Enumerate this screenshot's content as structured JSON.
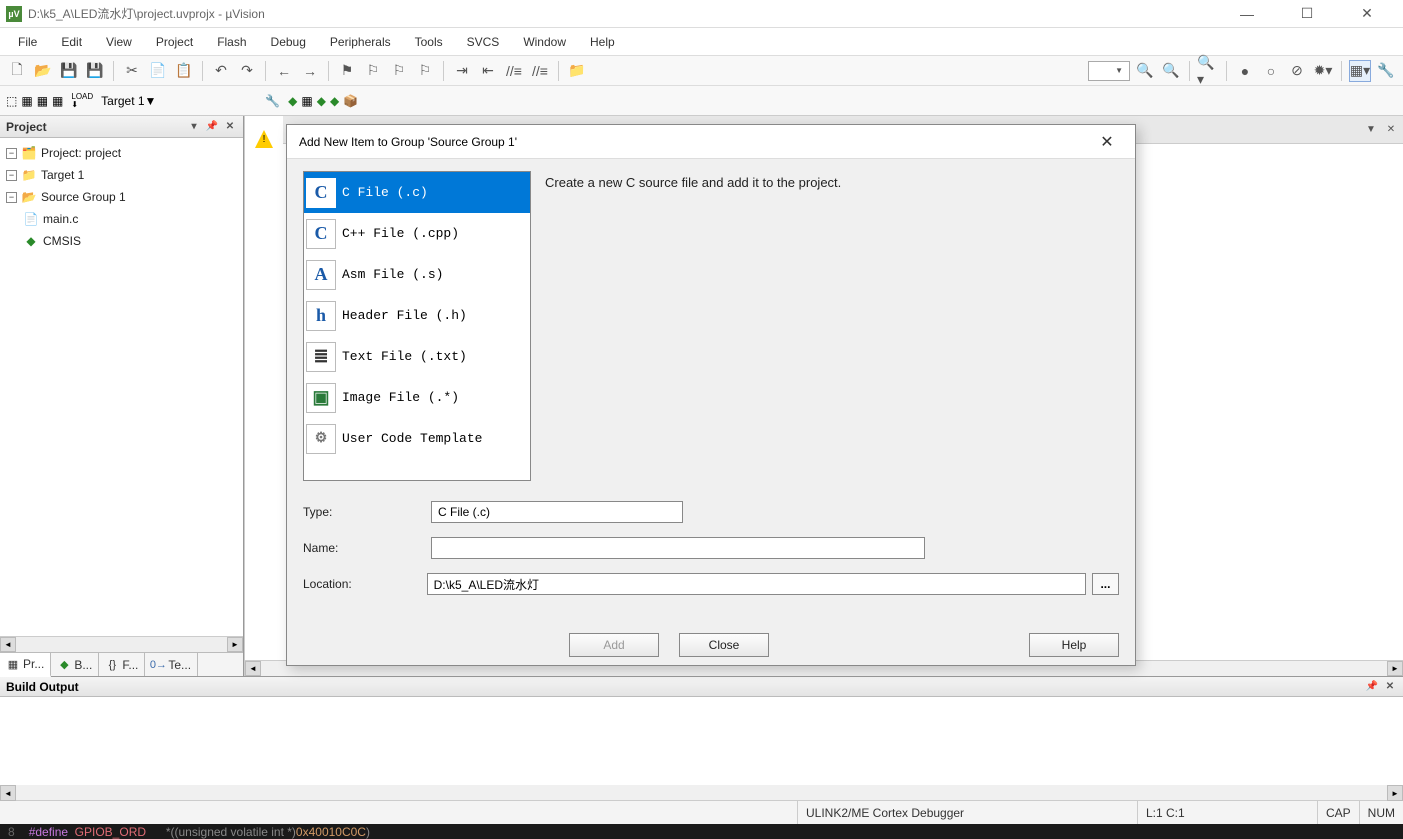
{
  "window": {
    "title": "D:\\k5_A\\LED流水灯\\project.uvprojx - µVision"
  },
  "menu": [
    "File",
    "Edit",
    "View",
    "Project",
    "Flash",
    "Debug",
    "Peripherals",
    "Tools",
    "SVCS",
    "Window",
    "Help"
  ],
  "toolbar2": {
    "target_label": "Target 1"
  },
  "project_panel": {
    "title": "Project",
    "root": "Project: project",
    "target": "Target 1",
    "group": "Source Group 1",
    "file1": "main.c",
    "cmsis": "CMSIS",
    "tabs": [
      "Pr...",
      "B...",
      "F...",
      "Te..."
    ]
  },
  "build_output": {
    "title": "Build Output"
  },
  "status": {
    "debugger": "ULINK2/ME Cortex Debugger",
    "line": "L:1 C:1",
    "cap": "CAP",
    "num": "NUM"
  },
  "bottom_code": {
    "ln": "8",
    "kw": "#define",
    "mac": "GPIOB_ORD",
    "cast": "*((unsigned volatile int *)",
    "num": "0x40010C0C",
    "tail": ")"
  },
  "dialog": {
    "title": "Add New Item to Group 'Source Group 1'",
    "desc": "Create a new C source file and add it to the project.",
    "types": [
      {
        "icon": "C",
        "label": "C File (.c)"
      },
      {
        "icon": "C",
        "label": "C++ File (.cpp)"
      },
      {
        "icon": "A",
        "label": "Asm File (.s)"
      },
      {
        "icon": "h",
        "label": "Header File (.h)"
      },
      {
        "icon": "≣",
        "label": "Text File (.txt)"
      },
      {
        "icon": "▣",
        "label": "Image File (.*)"
      },
      {
        "icon": "⚙",
        "label": "User Code Template"
      }
    ],
    "type_label": "Type:",
    "type_value": "C File (.c)",
    "name_label": "Name:",
    "name_value": "",
    "loc_label": "Location:",
    "loc_value": "D:\\k5_A\\LED流水灯",
    "btn_add": "Add",
    "btn_close": "Close",
    "btn_help": "Help"
  }
}
